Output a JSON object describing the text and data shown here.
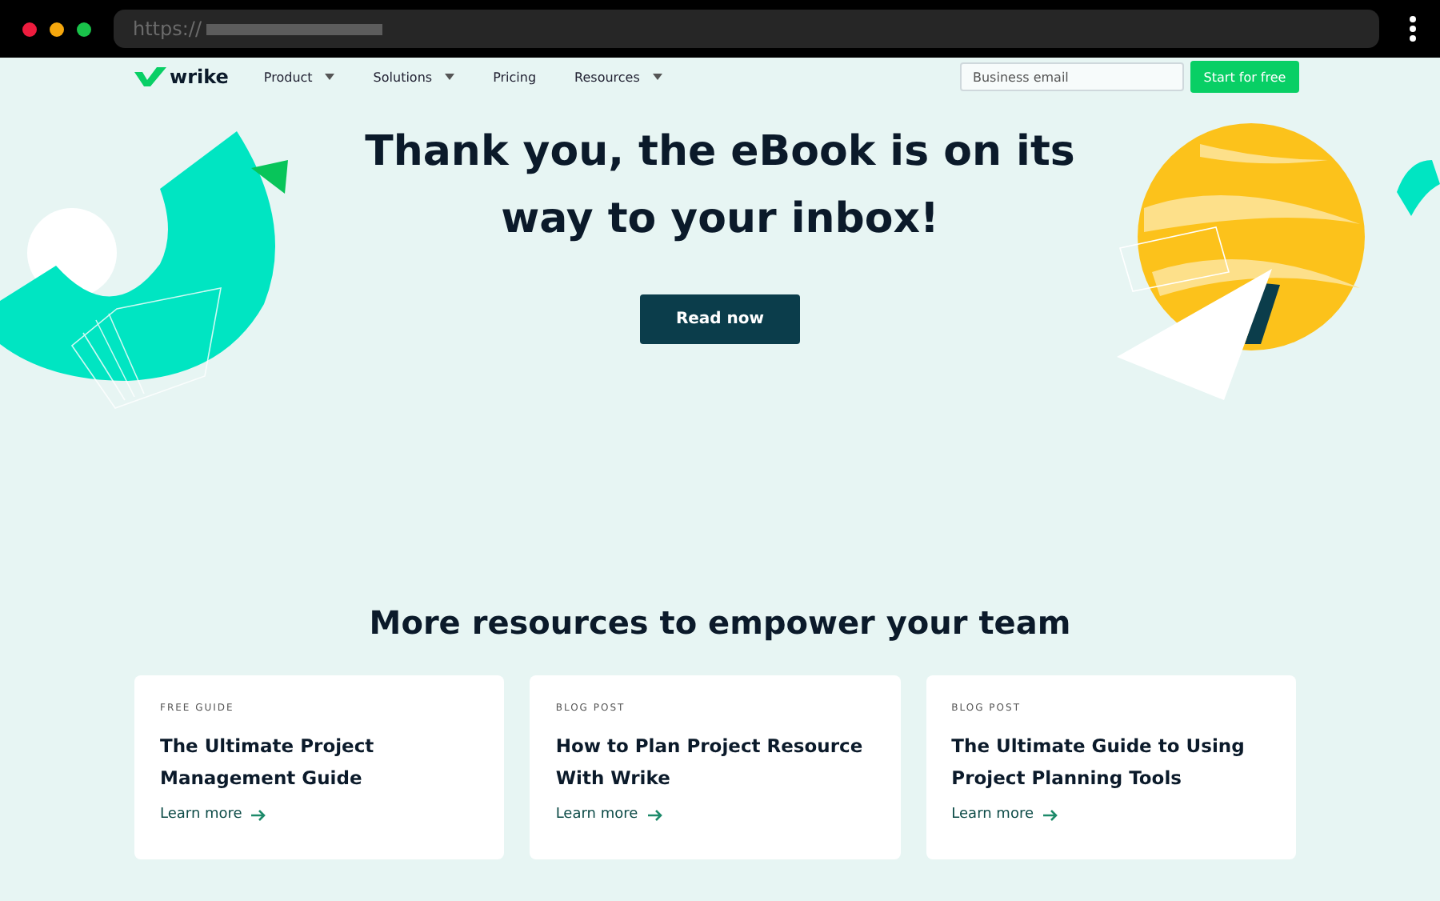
{
  "browser": {
    "url": "https://"
  },
  "nav": {
    "logo": "wrike",
    "items": [
      {
        "label": "Product",
        "dropdown": true
      },
      {
        "label": "Solutions",
        "dropdown": true
      },
      {
        "label": "Pricing",
        "dropdown": false
      },
      {
        "label": "Resources",
        "dropdown": true
      }
    ],
    "email_placeholder": "Business email",
    "cta": "Start for free"
  },
  "hero": {
    "title": "Thank you, the eBook is on its way to your inbox!",
    "button": "Read now"
  },
  "resources": {
    "heading": "More resources to empower your team",
    "cards": [
      {
        "tag": "FREE GUIDE",
        "title": "The Ultimate Project Management Guide",
        "link": "Learn more"
      },
      {
        "tag": "BLOG POST",
        "title": "How to Plan Project Resource With Wrike",
        "link": "Learn more"
      },
      {
        "tag": "BLOG POST",
        "title": "The Ultimate Guide to Using Project Planning Tools",
        "link": "Learn more"
      }
    ]
  }
}
